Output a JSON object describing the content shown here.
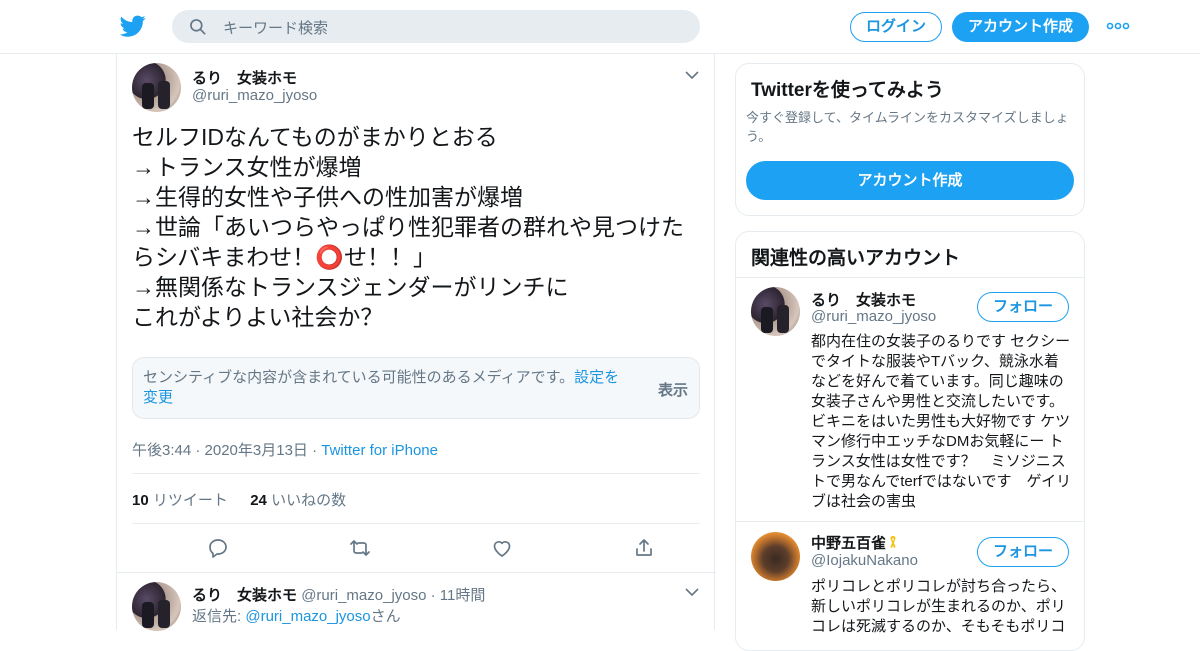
{
  "header": {
    "search_placeholder": "キーワード検索",
    "login_label": "ログイン",
    "signup_label": "アカウント作成"
  },
  "tweet": {
    "author_name": "るり　女装ホモ",
    "author_handle": "@ruri_mazo_jyoso",
    "text": "セルフIDなんてものがまかりとおる\n→トランス女性が爆増\n→生得的女性や子供への性加害が爆増\n→世論「あいつらやっぱり性犯罪者の群れや見つけたらシバキまわせ！⭕️せ！！」\n→無関係なトランスジェンダーがリンチに\nこれがよりよい社会か？",
    "sensitive_notice": "センシティブな内容が含まれている可能性のあるメディアです。",
    "sensitive_settings_link": "設定を変更",
    "sensitive_show_label": "表示",
    "time": "午後3:44 · 2020年3月13日 ·",
    "source": "Twitter for iPhone",
    "retweet_count": "10",
    "retweet_label": "リツイート",
    "like_count": "24",
    "like_label": "いいねの数"
  },
  "reply": {
    "author_name": "るり　女装ホモ",
    "author_handle": "@ruri_mazo_jyoso",
    "time": "· 11時間",
    "reply_to_prefix": "返信先: ",
    "reply_to_handle": "@ruri_mazo_jyoso",
    "reply_to_suffix": "さん"
  },
  "sidebar": {
    "try_title": "Twitterを使ってみよう",
    "try_desc": "今すぐ登録して、タイムラインをカスタマイズしましょう。",
    "try_button": "アカウント作成",
    "related_title": "関連性の高いアカウント",
    "accounts": [
      {
        "name": "るり　女装ホモ",
        "handle": "@ruri_mazo_jyoso",
        "follow_label": "フォロー",
        "bio": "都内在住の女装子のるりです セクシーでタイトな服装やTバック、競泳水着などを好んで着ています。同じ趣味の女装子さんや男性と交流したいです。ビキニをはいた男性も大好物です ケツマン修行中エッチなDMお気軽にー トランス女性は女性です？　ミソジニストで男なんでterfではないです　ゲイリブは社会の害虫"
      },
      {
        "name": "中野五百雀",
        "handle": "@IojakuNakano",
        "follow_label": "フォロー",
        "bio": "ポリコレとポリコレが討ち合ったら、新しいポリコレが生まれるのか、ポリコレは死滅するのか、そもそもポリコ"
      }
    ]
  },
  "colors": {
    "accent": "#1da1f2",
    "link": "#1b95e0",
    "muted": "#657786"
  }
}
